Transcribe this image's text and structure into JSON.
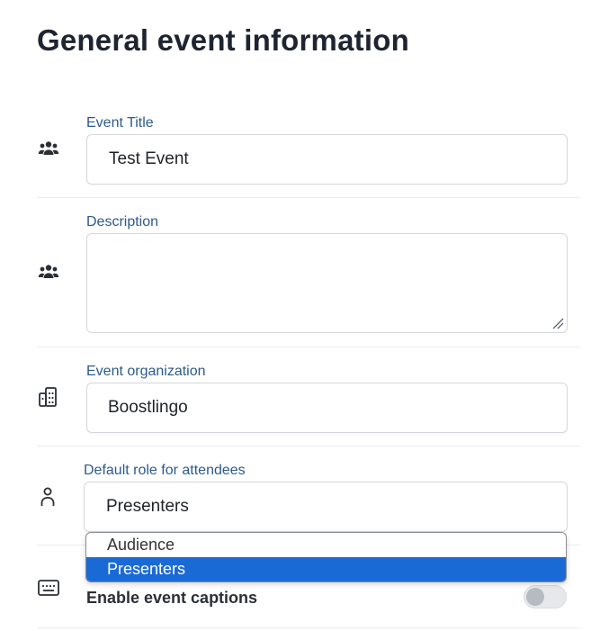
{
  "page": {
    "title": "General event information"
  },
  "fields": {
    "title": {
      "label": "Event Title",
      "value": "Test Event",
      "icon": "users-icon"
    },
    "description": {
      "label": "Description",
      "value": "",
      "icon": "users-icon"
    },
    "organization": {
      "label": "Event organization",
      "value": "Boostlingo",
      "icon": "building-icon"
    },
    "role": {
      "label": "Default role for attendees",
      "value": "Presenters",
      "icon": "person-icon",
      "options": [
        "Audience",
        "Presenters"
      ],
      "selected_option": "Presenters"
    },
    "captions": {
      "label": "Enable event captions",
      "enabled": false,
      "icon": "captions-icon"
    }
  },
  "colors": {
    "accent": "#1a6ad6",
    "label": "#2c5a8c"
  }
}
